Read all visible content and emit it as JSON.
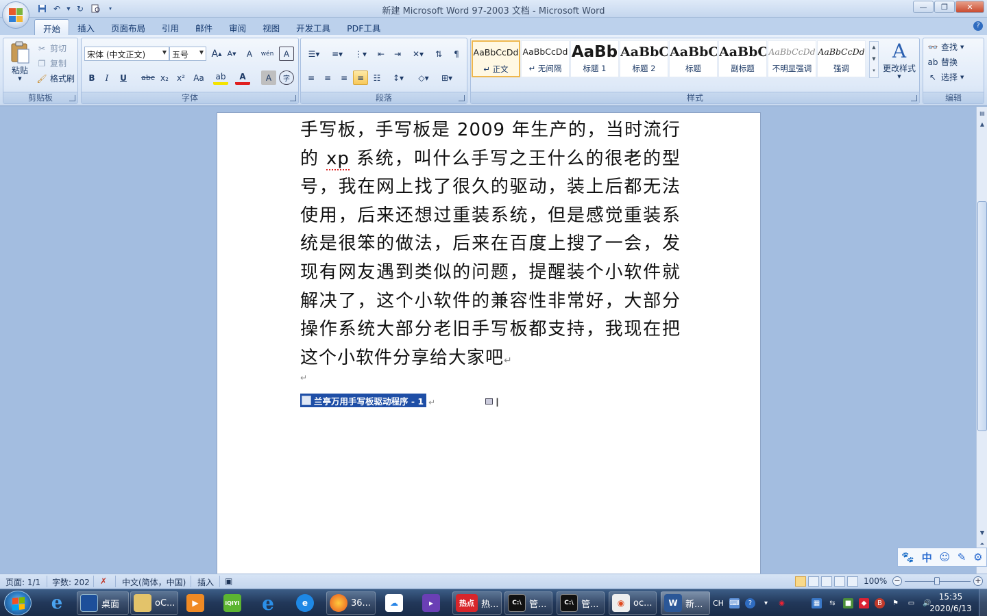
{
  "window": {
    "title": "新建 Microsoft Word 97-2003 文档 - Microsoft Word",
    "controls": {
      "minimize": "—",
      "restore": "❐",
      "close": "✕"
    }
  },
  "qat_icons": [
    "save-icon",
    "undo-icon",
    "redo-icon",
    "print-preview-icon",
    "customize-icon"
  ],
  "tabs": [
    {
      "label": "开始",
      "active": true
    },
    {
      "label": "插入"
    },
    {
      "label": "页面布局"
    },
    {
      "label": "引用"
    },
    {
      "label": "邮件"
    },
    {
      "label": "审阅"
    },
    {
      "label": "视图"
    },
    {
      "label": "开发工具"
    },
    {
      "label": "PDF工具"
    }
  ],
  "ribbon": {
    "clipboard": {
      "label": "剪贴板",
      "paste": "粘贴",
      "cut": "剪切",
      "copy": "复制",
      "format_painter": "格式刷"
    },
    "font": {
      "label": "字体",
      "font_name": "宋体 (中文正文)",
      "font_size": "五号",
      "bold": "B",
      "italic": "I",
      "underline": "U",
      "strike": "abc",
      "subscript": "x₂",
      "superscript": "x²",
      "change_case": "Aa",
      "grow": "A",
      "shrink": "A",
      "clear_format": "A",
      "phonetic": "wén",
      "char_border": "A",
      "highlight": "ab",
      "font_color": "A",
      "char_shading": "A",
      "enclose": "字"
    },
    "paragraph": {
      "label": "段落"
    },
    "styles": {
      "label": "样式",
      "items": [
        {
          "sample": "AaBbCcDd",
          "name": "↵ 正文",
          "selected": true
        },
        {
          "sample": "AaBbCcDd",
          "name": "↵ 无间隔"
        },
        {
          "sample": "AaBb",
          "name": "标题 1"
        },
        {
          "sample": "AaBbC",
          "name": "标题 2"
        },
        {
          "sample": "AaBbC",
          "name": "标题"
        },
        {
          "sample": "AaBbC",
          "name": "副标题"
        },
        {
          "sample": "AaBbCcDd",
          "name": "不明显强调"
        },
        {
          "sample": "AaBbCcDd",
          "name": "强调"
        }
      ],
      "change_styles": "更改样式"
    },
    "editing": {
      "label": "编辑",
      "find": "查找",
      "replace": "替换",
      "select": "选择"
    }
  },
  "document": {
    "text_parts": {
      "p1": "手写板，手写板是 2009 年生产的，当时流行的 ",
      "xp": "xp",
      "p2": " 系统，叫什么手写之王什么的很老的型号，我在网上找了很久的驱动，装上后都无法使用，后来还想过重装系统，但是感觉重装系统是很笨的做法，后来在百度上搜了一会，发现有网友遇到类似的问题，提醒装个小软件就解决了，这个小软件的兼容性非常好，大部分操作系统大部分老旧手写板都支持，我现在把这个小软件分享给大家吧"
    },
    "pilcrow": "↵",
    "link_text": "兰亭万用手写板驱动程序 - 1"
  },
  "ime": {
    "items": [
      "🐾",
      "中",
      "☺",
      "✎",
      "⚙"
    ]
  },
  "status": {
    "page": "页面: 1/1",
    "words": "字数: 202",
    "language": "中文(简体，中国)",
    "mode": "插入",
    "zoom": "100%",
    "zoom_percent": 100
  },
  "taskbar": {
    "apps": [
      {
        "label": "桌面"
      },
      {
        "label": "oC..."
      },
      {
        "label": "36..."
      },
      {
        "label": "热..."
      },
      {
        "label": "管..."
      },
      {
        "label": "管..."
      },
      {
        "label": "oc..."
      },
      {
        "label": "新..."
      }
    ],
    "hot_badge": "热点",
    "tray_lang": "CH",
    "time": "15:35",
    "date": "2020/6/13"
  },
  "colors": {
    "accent": "#1e4ea6",
    "ribbon_bg": "#dbe7f7",
    "workspace": "#a3bde0",
    "taskbar": "#22385a"
  }
}
